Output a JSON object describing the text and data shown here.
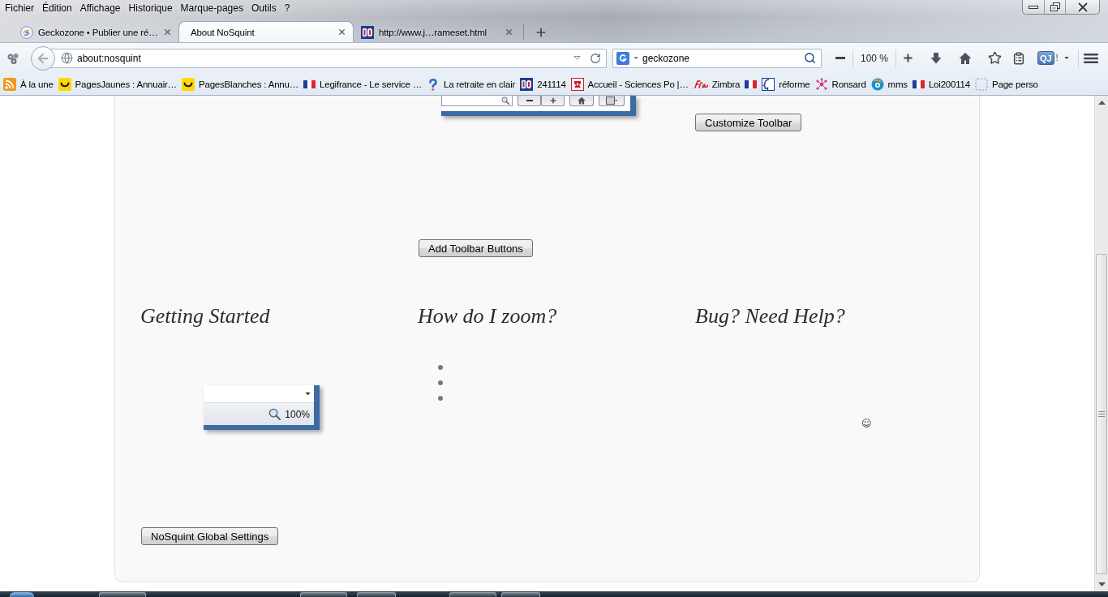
{
  "menu_bar": {
    "items": [
      "Fichier",
      "Édition",
      "Affichage",
      "Historique",
      "Marque-pages",
      "Outils",
      "?"
    ]
  },
  "tabs": [
    {
      "label": "Geckozone • Publier une ré…",
      "selected": false
    },
    {
      "label": "About NoSquint",
      "selected": true
    },
    {
      "label": "http://www.j…rameset.html",
      "selected": false
    }
  ],
  "nav_bar": {
    "back_button": {
      "disabled": true
    },
    "url": "about:nosquint",
    "search": {
      "value": "geckozone"
    },
    "zoom": "100 %",
    "extension": {
      "label": "QJ",
      "badge": "!"
    }
  },
  "bookmarks": [
    {
      "kind": "link",
      "label": "À la une"
    },
    {
      "kind": "link",
      "label": "PagesJaunes : Annuair…"
    },
    {
      "kind": "link",
      "label": "PagesBlanches : Annu…"
    },
    {
      "kind": "link",
      "label": "Legifrance - Le service …"
    },
    {
      "kind": "link",
      "label": "La retraite en clair"
    },
    {
      "kind": "link",
      "label": "241114"
    },
    {
      "kind": "link",
      "label": "Accueil - Sciences Po |…"
    },
    {
      "kind": "link",
      "label": "Zimbra"
    },
    {
      "kind": "icon"
    },
    {
      "kind": "link",
      "label": "réforme"
    },
    {
      "kind": "link",
      "label": "Ronsard"
    },
    {
      "kind": "link",
      "label": "mms"
    },
    {
      "kind": "link",
      "label": "Loi200114"
    },
    {
      "kind": "link",
      "label": "Page perso"
    }
  ],
  "page": {
    "toolbar": {
      "customize_button": "Customize Toolbar",
      "add_button": "Add Toolbar Buttons"
    },
    "sections": [
      {
        "kind": "preview",
        "heading": "Getting Started",
        "preview": {
          "zoom": "100%"
        }
      },
      {
        "kind": "list",
        "heading": "How do I zoom?",
        "list": [
          {
            "kind": "bullet"
          },
          {
            "kind": "bullet"
          },
          {
            "kind": "bullet"
          }
        ]
      },
      {
        "kind": "note",
        "heading": "Bug? Need Help?",
        "emoticon": "☺"
      }
    ],
    "settings_button": "NoSquint Global Settings"
  }
}
